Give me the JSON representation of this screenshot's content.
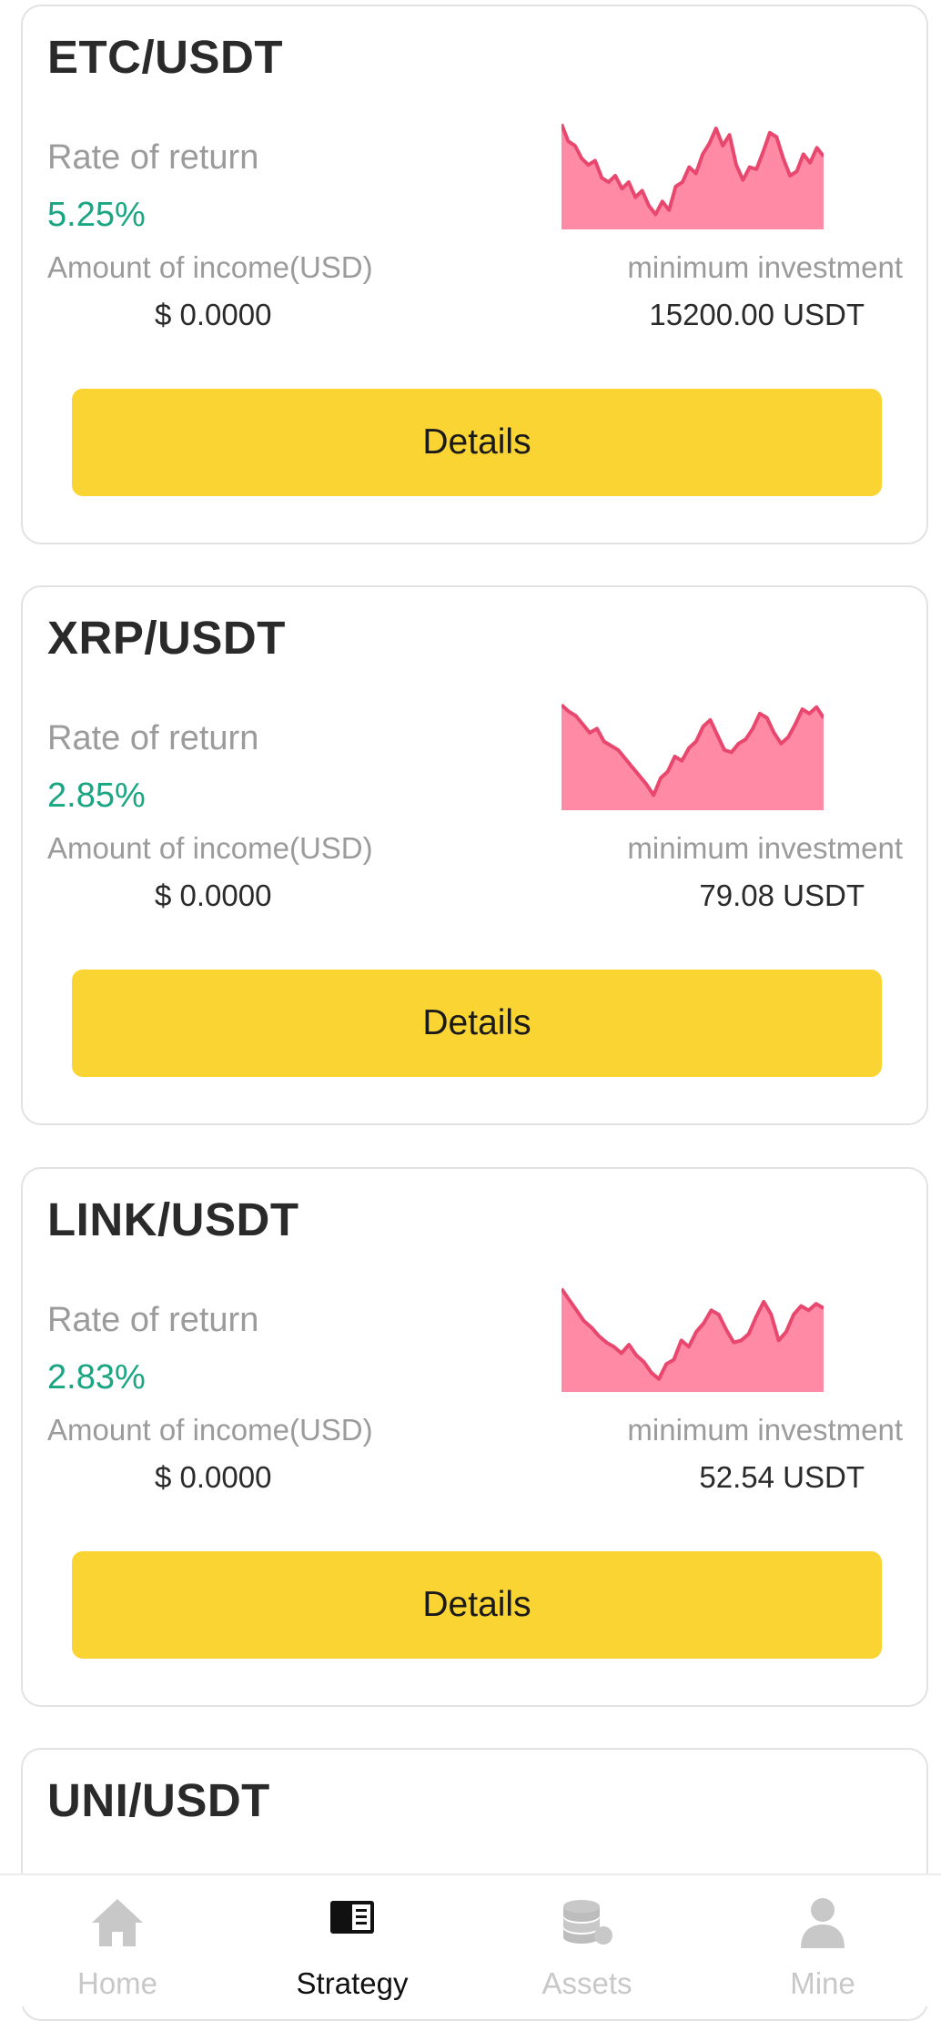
{
  "strategies": [
    {
      "pair": "ETC/USDT",
      "rate_label": "Rate of return",
      "rate_value": "5.25%",
      "income_label": "Amount of income(USD)",
      "income_value": "$ 0.0000",
      "min_label": "minimum investment",
      "min_value": "15200.00 USDT",
      "details_label": "Details",
      "sparkline": [
        0.98,
        0.82,
        0.78,
        0.66,
        0.6,
        0.64,
        0.48,
        0.44,
        0.5,
        0.38,
        0.44,
        0.3,
        0.36,
        0.22,
        0.14,
        0.26,
        0.18,
        0.4,
        0.44,
        0.58,
        0.52,
        0.7,
        0.8,
        0.94,
        0.78,
        0.88,
        0.6,
        0.46,
        0.58,
        0.56,
        0.72,
        0.9,
        0.86,
        0.66,
        0.5,
        0.54,
        0.7,
        0.62,
        0.76,
        0.68
      ]
    },
    {
      "pair": "XRP/USDT",
      "rate_label": "Rate of return",
      "rate_value": "2.85%",
      "income_label": "Amount of income(USD)",
      "income_value": "$ 0.0000",
      "min_label": "minimum investment",
      "min_value": "79.08 USDT",
      "details_label": "Details",
      "sparkline": [
        0.98,
        0.92,
        0.88,
        0.8,
        0.72,
        0.76,
        0.64,
        0.6,
        0.56,
        0.48,
        0.4,
        0.32,
        0.24,
        0.14,
        0.3,
        0.36,
        0.5,
        0.46,
        0.58,
        0.64,
        0.78,
        0.84,
        0.7,
        0.56,
        0.54,
        0.62,
        0.66,
        0.76,
        0.9,
        0.86,
        0.72,
        0.62,
        0.68,
        0.8,
        0.94,
        0.9,
        0.96,
        0.86
      ]
    },
    {
      "pair": "LINK/USDT",
      "rate_label": "Rate of return",
      "rate_value": "2.83%",
      "income_label": "Amount of income(USD)",
      "income_value": "$ 0.0000",
      "min_label": "minimum investment",
      "min_value": "52.54 USDT",
      "details_label": "Details",
      "sparkline": [
        0.96,
        0.86,
        0.76,
        0.66,
        0.6,
        0.52,
        0.46,
        0.42,
        0.36,
        0.44,
        0.34,
        0.28,
        0.18,
        0.12,
        0.26,
        0.3,
        0.48,
        0.42,
        0.56,
        0.64,
        0.76,
        0.72,
        0.58,
        0.46,
        0.48,
        0.54,
        0.7,
        0.84,
        0.72,
        0.48,
        0.56,
        0.72,
        0.8,
        0.76,
        0.82,
        0.78
      ]
    },
    {
      "pair": "UNI/USDT"
    }
  ],
  "tabbar": {
    "items": [
      {
        "label": "Home",
        "icon": "home-icon",
        "active": false
      },
      {
        "label": "Strategy",
        "icon": "strategy-icon",
        "active": true
      },
      {
        "label": "Assets",
        "icon": "assets-icon",
        "active": false
      },
      {
        "label": "Mine",
        "icon": "mine-icon",
        "active": false
      }
    ]
  },
  "colors": {
    "accent_yellow": "#fad432",
    "positive_green": "#1aa583",
    "spark_line": "#e8486d",
    "spark_fill": "#ff8aa5"
  }
}
